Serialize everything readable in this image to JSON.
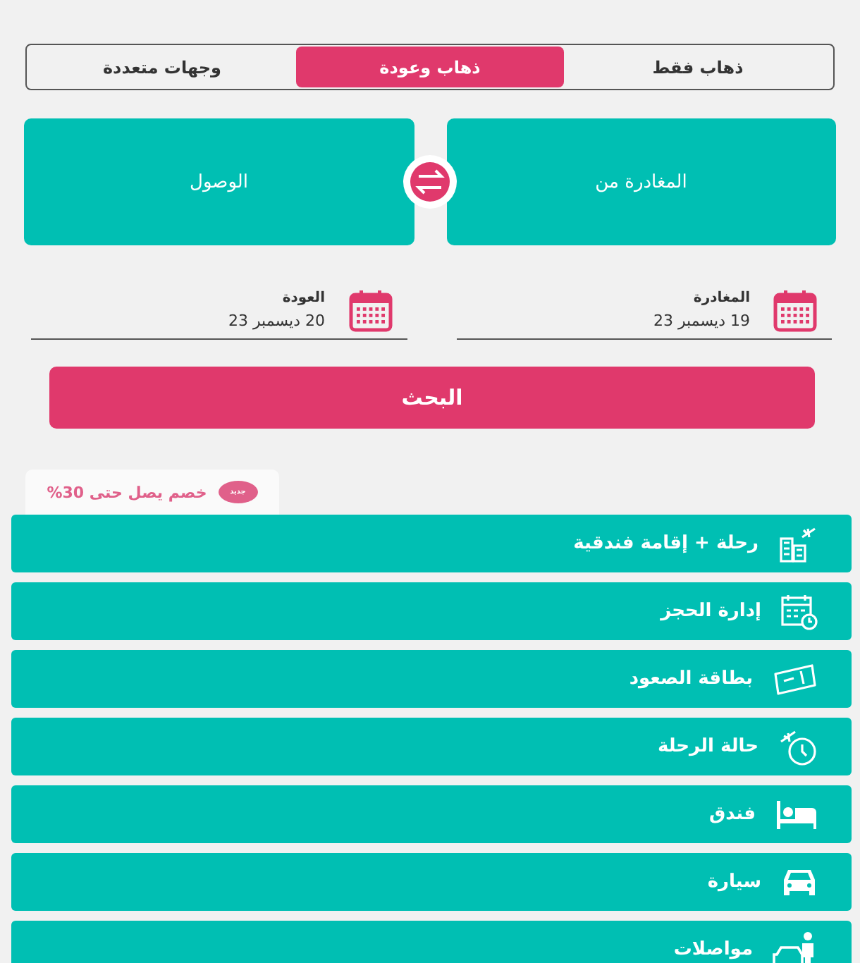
{
  "trip_tabs": [
    {
      "label": "ذهاب فقط",
      "selected": false
    },
    {
      "label": "ذهاب وعودة",
      "selected": true
    },
    {
      "label": "وجهات متعددة",
      "selected": false
    }
  ],
  "locations": {
    "from": "المغادرة من",
    "to": "الوصول"
  },
  "dates": [
    {
      "label": "المغادرة",
      "value": "19 ديسمبر 23"
    },
    {
      "label": "العودة",
      "value": "20 ديسمبر 23"
    }
  ],
  "search_button": "البحث",
  "promo": {
    "badge": "جديد",
    "text": "خصم يصل حتى 30%"
  },
  "menu": [
    {
      "kind": "flight-hotel",
      "label": "رحلة + إقامة فندقية"
    },
    {
      "kind": "booking",
      "label": "إدارة الحجز"
    },
    {
      "kind": "boarding",
      "label": "بطاقة الصعود"
    },
    {
      "kind": "status",
      "label": "حالة الرحلة"
    },
    {
      "kind": "hotel",
      "label": "فندق"
    },
    {
      "kind": "car",
      "label": "سيارة"
    },
    {
      "kind": "transfer",
      "label": "مواصلات"
    }
  ]
}
